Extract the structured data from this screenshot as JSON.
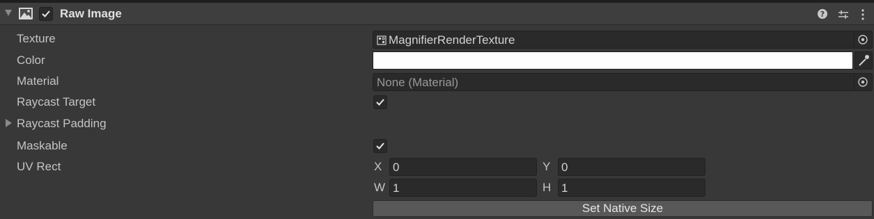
{
  "component": {
    "title": "Raw Image",
    "enabled": true,
    "icons": {
      "foldout": "foldout-expanded-icon",
      "component": "raw-image-icon",
      "help": "help-icon",
      "preset": "preset-icon",
      "menu": "kebab-menu-icon"
    }
  },
  "fields": {
    "texture": {
      "label": "Texture",
      "value": "MagnifierRenderTexture"
    },
    "color": {
      "label": "Color",
      "value": "#ffffff"
    },
    "material": {
      "label": "Material",
      "value": "None (Material)"
    },
    "raycast_target": {
      "label": "Raycast Target",
      "checked": true
    },
    "raycast_padding": {
      "label": "Raycast Padding"
    },
    "maskable": {
      "label": "Maskable",
      "checked": true
    },
    "uv_rect": {
      "label": "UV Rect",
      "x_label": "X",
      "x": "0",
      "y_label": "Y",
      "y": "0",
      "w_label": "W",
      "w": "1",
      "h_label": "H",
      "h": "1"
    }
  },
  "buttons": {
    "set_native_size": "Set Native Size"
  }
}
